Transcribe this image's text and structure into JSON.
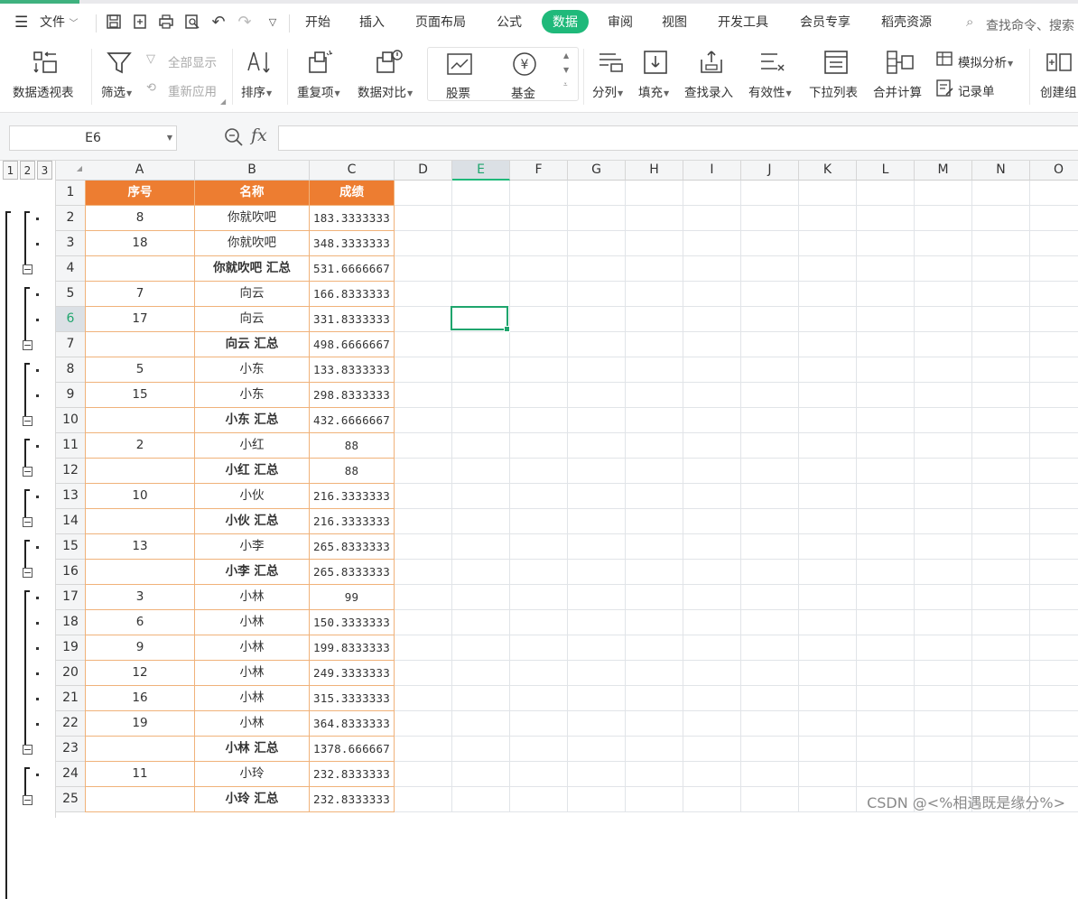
{
  "menu": {
    "file_label": "文件",
    "tabs": [
      "开始",
      "插入",
      "页面布局",
      "公式",
      "数据",
      "审阅",
      "视图",
      "开发工具",
      "会员专享",
      "稻壳资源"
    ],
    "active_tab": "数据",
    "search_placeholder": "查找命令、搜索"
  },
  "ribbon": {
    "pivot": "数据透视表",
    "filter": "筛选",
    "show_all": "全部显示",
    "reapply": "重新应用",
    "sort": "排序",
    "duplicates": "重复项",
    "compare": "数据对比",
    "stock": "股票",
    "fund": "基金",
    "split": "分列",
    "fill": "填充",
    "lookup": "查找录入",
    "validity": "有效性",
    "dropdown": "下拉列表",
    "consolidate": "合并计算",
    "whatif": "模拟分析",
    "record": "记录单",
    "group": "创建组"
  },
  "formula_bar": {
    "cell_ref": "E6",
    "fx": "fx",
    "value": ""
  },
  "outline_levels": [
    "1",
    "2",
    "3"
  ],
  "columns": [
    "A",
    "B",
    "C",
    "D",
    "E",
    "F",
    "G",
    "H",
    "I",
    "J",
    "K",
    "L",
    "M",
    "N",
    "O"
  ],
  "selected_column": "E",
  "selected_row": "6",
  "rows": [
    {
      "n": "1",
      "a": "序号",
      "b": "名称",
      "c": "成绩",
      "type": "header"
    },
    {
      "n": "2",
      "a": "8",
      "b": "你就吹吧",
      "c": "183.3333333",
      "type": "data"
    },
    {
      "n": "3",
      "a": "18",
      "b": "你就吹吧",
      "c": "348.3333333",
      "type": "data"
    },
    {
      "n": "4",
      "a": "",
      "b": "你就吹吧 汇总",
      "c": "531.6666667",
      "type": "sum"
    },
    {
      "n": "5",
      "a": "7",
      "b": "向云",
      "c": "166.8333333",
      "type": "data"
    },
    {
      "n": "6",
      "a": "17",
      "b": "向云",
      "c": "331.8333333",
      "type": "data"
    },
    {
      "n": "7",
      "a": "",
      "b": "向云 汇总",
      "c": "498.6666667",
      "type": "sum"
    },
    {
      "n": "8",
      "a": "5",
      "b": "小东",
      "c": "133.8333333",
      "type": "data"
    },
    {
      "n": "9",
      "a": "15",
      "b": "小东",
      "c": "298.8333333",
      "type": "data"
    },
    {
      "n": "10",
      "a": "",
      "b": "小东 汇总",
      "c": "432.6666667",
      "type": "sum"
    },
    {
      "n": "11",
      "a": "2",
      "b": "小红",
      "c": "88",
      "type": "data"
    },
    {
      "n": "12",
      "a": "",
      "b": "小红 汇总",
      "c": "88",
      "type": "sum"
    },
    {
      "n": "13",
      "a": "10",
      "b": "小伙",
      "c": "216.3333333",
      "type": "data"
    },
    {
      "n": "14",
      "a": "",
      "b": "小伙 汇总",
      "c": "216.3333333",
      "type": "sum"
    },
    {
      "n": "15",
      "a": "13",
      "b": "小李",
      "c": "265.8333333",
      "type": "data"
    },
    {
      "n": "16",
      "a": "",
      "b": "小李 汇总",
      "c": "265.8333333",
      "type": "sum"
    },
    {
      "n": "17",
      "a": "3",
      "b": "小林",
      "c": "99",
      "type": "data"
    },
    {
      "n": "18",
      "a": "6",
      "b": "小林",
      "c": "150.3333333",
      "type": "data"
    },
    {
      "n": "19",
      "a": "9",
      "b": "小林",
      "c": "199.8333333",
      "type": "data"
    },
    {
      "n": "20",
      "a": "12",
      "b": "小林",
      "c": "249.3333333",
      "type": "data"
    },
    {
      "n": "21",
      "a": "16",
      "b": "小林",
      "c": "315.3333333",
      "type": "data"
    },
    {
      "n": "22",
      "a": "19",
      "b": "小林",
      "c": "364.8333333",
      "type": "data"
    },
    {
      "n": "23",
      "a": "",
      "b": "小林 汇总",
      "c": "1378.666667",
      "type": "sum"
    },
    {
      "n": "24",
      "a": "11",
      "b": "小玲",
      "c": "232.8333333",
      "type": "data"
    },
    {
      "n": "25",
      "a": "",
      "b": "小玲 汇总",
      "c": "232.8333333",
      "type": "sum"
    }
  ],
  "watermark": "CSDN @<%相遇既是缘分%>",
  "colors": {
    "accent": "#1fb97a",
    "header_fill": "#ed7d31",
    "table_border": "#f0b27a"
  }
}
